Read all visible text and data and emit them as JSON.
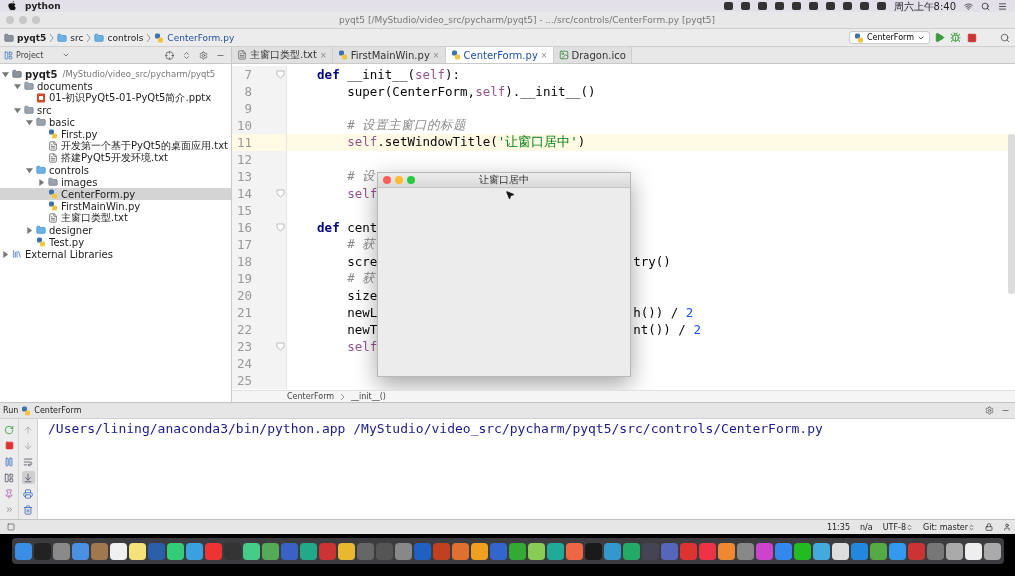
{
  "menu_bar": {
    "app_name": "python",
    "clock": "周六上午8:40"
  },
  "window": {
    "title": "pyqt5 [/MyStudio/video_src/pycharm/pyqt5] - .../src/controls/CenterForm.py [pyqt5]"
  },
  "nav_bar": {
    "breadcrumbs": [
      {
        "label": "pyqt5",
        "kind": "project"
      },
      {
        "label": "src",
        "kind": "folder"
      },
      {
        "label": "controls",
        "kind": "folder"
      },
      {
        "label": "CenterForm.py",
        "kind": "python"
      }
    ],
    "run_config": "CenterForm"
  },
  "project_panel": {
    "title": "Project"
  },
  "tabs": [
    {
      "label": "主窗口类型.txt",
      "kind": "text",
      "selected": false,
      "close": "×"
    },
    {
      "label": "FirstMainWin.py",
      "kind": "python",
      "selected": false,
      "close": "×"
    },
    {
      "label": "CenterForm.py",
      "kind": "python",
      "selected": true,
      "close": "×"
    },
    {
      "label": "Dragon.ico",
      "kind": "image",
      "selected": false
    }
  ],
  "project_tree": [
    {
      "label": "pyqt5",
      "path": "/MyStudio/video_src/pycharm/pyqt5",
      "kind": "project",
      "expanded": true,
      "selected": false,
      "children": [
        {
          "label": "documents",
          "kind": "folder",
          "expanded": true,
          "selected": false,
          "children": [
            {
              "label": "01-初识PyQt5-01-PyQt5简介.pptx",
              "kind": "slides",
              "selected": false
            }
          ]
        },
        {
          "label": "src",
          "kind": "folder",
          "expanded": true,
          "selected": false,
          "children": [
            {
              "label": "basic",
              "kind": "folder",
              "expanded": true,
              "selected": false,
              "children": [
                {
                  "label": "First.py",
                  "kind": "python",
                  "selected": false
                },
                {
                  "label": "开发第一个基于PyQt5的桌面应用.txt",
                  "kind": "text",
                  "selected": false
                },
                {
                  "label": "搭建PyQt5开发环境.txt",
                  "kind": "text",
                  "selected": false
                }
              ]
            },
            {
              "label": "controls",
              "kind": "source",
              "expanded": true,
              "selected": false,
              "children": [
                {
                  "label": "images",
                  "kind": "folder",
                  "expanded": false,
                  "selected": false
                },
                {
                  "label": "CenterForm.py",
                  "kind": "python",
                  "selected": true
                },
                {
                  "label": "FirstMainWin.py",
                  "kind": "python",
                  "selected": false
                },
                {
                  "label": "主窗口类型.txt",
                  "kind": "text",
                  "selected": false
                }
              ]
            },
            {
              "label": "designer",
              "kind": "source",
              "expanded": false,
              "selected": false
            },
            {
              "label": "Test.py",
              "kind": "python",
              "selected": false
            }
          ]
        }
      ]
    },
    {
      "label": "External Libraries",
      "kind": "library",
      "expanded": false,
      "selected": false
    }
  ],
  "code_lines": [
    {
      "number": "7",
      "kind": "method",
      "fold": true,
      "highlighted": false,
      "tokens": [
        {
          "kind": "keyword",
          "text": "def"
        },
        {
          "kind": "plain",
          "text": " __init__("
        },
        {
          "kind": "self",
          "text": "self"
        },
        {
          "kind": "plain",
          "text": "):"
        }
      ]
    },
    {
      "number": "8",
      "kind": "body",
      "fold": false,
      "highlighted": false,
      "tokens": [
        {
          "kind": "plain",
          "text": "super(CenterForm,"
        },
        {
          "kind": "self",
          "text": "self"
        },
        {
          "kind": "plain",
          "text": ").__init__()"
        }
      ]
    },
    {
      "number": "9",
      "fold": false,
      "highlighted": false
    },
    {
      "number": "10",
      "kind": "body",
      "fold": false,
      "highlighted": false,
      "tokens": [
        {
          "kind": "comment",
          "text": "# 设置主窗口的标题"
        }
      ]
    },
    {
      "number": "11",
      "kind": "body",
      "fold": false,
      "highlighted": true,
      "tokens": [
        {
          "kind": "self",
          "text": "self"
        },
        {
          "kind": "plain",
          "text": ".setWindowTitle("
        },
        {
          "kind": "string",
          "text": "'让窗口居中'"
        },
        {
          "kind": "plain",
          "text": ")"
        }
      ]
    },
    {
      "number": "12",
      "fold": false,
      "highlighted": false
    },
    {
      "number": "13",
      "kind": "body",
      "fold": false,
      "highlighted": false,
      "tokens": [
        {
          "kind": "comment",
          "text": "# 设"
        }
      ]
    },
    {
      "number": "14",
      "kind": "body",
      "fold": true,
      "highlighted": false,
      "tokens": [
        {
          "kind": "self",
          "text": "self"
        }
      ]
    },
    {
      "number": "15",
      "fold": false,
      "highlighted": false
    },
    {
      "number": "16",
      "kind": "method",
      "fold": true,
      "highlighted": false,
      "tokens": [
        {
          "kind": "keyword",
          "text": "def"
        },
        {
          "kind": "plain",
          "text": " cent"
        }
      ]
    },
    {
      "number": "17",
      "kind": "body",
      "fold": false,
      "highlighted": false,
      "tokens": [
        {
          "kind": "comment",
          "text": "# 获"
        }
      ]
    },
    {
      "number": "18",
      "kind": "body",
      "fold": false,
      "highlighted": false,
      "tokens": [
        {
          "kind": "plain",
          "text": "scre"
        }
      ],
      "right": [
        {
          "kind": "plain",
          "text": "try()"
        }
      ]
    },
    {
      "number": "19",
      "kind": "body",
      "fold": false,
      "highlighted": false,
      "tokens": [
        {
          "kind": "comment",
          "text": "# 获"
        }
      ]
    },
    {
      "number": "20",
      "kind": "body",
      "fold": false,
      "highlighted": false,
      "tokens": [
        {
          "kind": "plain",
          "text": "size"
        }
      ]
    },
    {
      "number": "21",
      "kind": "body",
      "fold": false,
      "highlighted": false,
      "tokens": [
        {
          "kind": "plain",
          "text": "newL"
        }
      ],
      "right": [
        {
          "kind": "plain",
          "text": "h()) / "
        },
        {
          "kind": "number",
          "text": "2"
        }
      ]
    },
    {
      "number": "22",
      "kind": "body",
      "fold": false,
      "highlighted": false,
      "tokens": [
        {
          "kind": "plain",
          "text": "newT"
        }
      ],
      "right": [
        {
          "kind": "plain",
          "text": "nt()) / "
        },
        {
          "kind": "number",
          "text": "2"
        }
      ]
    },
    {
      "number": "23",
      "kind": "body",
      "fold": true,
      "highlighted": false,
      "tokens": [
        {
          "kind": "self",
          "text": "self"
        }
      ]
    },
    {
      "number": "24",
      "fold": false,
      "highlighted": false
    },
    {
      "number": "25",
      "fold": false,
      "highlighted": false
    }
  ],
  "editor_breadcrumbs": [
    "CenterForm",
    "__init__()"
  ],
  "app_window": {
    "title": "让窗口居中"
  },
  "run_panel": {
    "label": "Run",
    "config": "CenterForm",
    "output": "/Users/lining/anaconda3/bin/python.app /MyStudio/video_src/pycharm/pyqt5/src/controls/CenterForm.py",
    "tools": [
      {
        "kind": "up",
        "selected": false
      },
      {
        "kind": "down",
        "selected": false
      },
      {
        "kind": "wrap",
        "selected": false
      },
      {
        "kind": "scroll-end",
        "selected": true
      },
      {
        "kind": "print",
        "selected": false
      },
      {
        "kind": "trash",
        "selected": false
      }
    ]
  },
  "status_bar": {
    "items": [
      {
        "text": "11:35",
        "kind": "plain"
      },
      {
        "text": "n/a",
        "kind": "plain"
      },
      {
        "text": "UTF-8",
        "kind": "dropdown"
      },
      {
        "text": "Git: master",
        "kind": "dropdown"
      }
    ]
  }
}
